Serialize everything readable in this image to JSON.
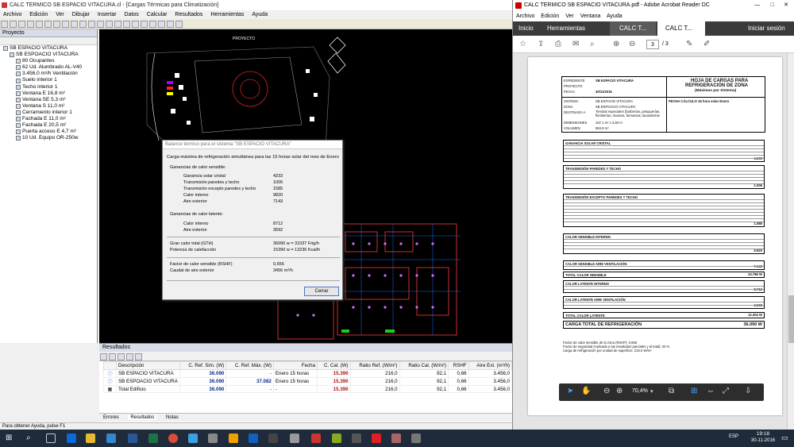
{
  "left_app": {
    "title": "CALC TERMICO SB ESPACIO VITACURA.cl - [Cargas Térmicas para Climatización]",
    "menu": [
      "Archivo",
      "Edición",
      "Ver",
      "Dibujar",
      "Insertar",
      "Datos",
      "Calcular",
      "Resultados",
      "Herramientas",
      "Ayuda"
    ],
    "project_panel_title": "Proyecto",
    "tree": [
      {
        "label": "SB ESPACIO VITACURA",
        "level": 0
      },
      {
        "label": "SB ESPOACIO VITACURA",
        "level": 1
      },
      {
        "label": "80 Ocupantes",
        "level": 2
      },
      {
        "label": "62 Ud. Alumbrado AL-V40",
        "level": 2
      },
      {
        "label": "3.456,0 m³/h Ventilación",
        "level": 2
      },
      {
        "label": "Suelo interior 1",
        "level": 2
      },
      {
        "label": "Techo interior 1",
        "level": 2
      },
      {
        "label": "Ventana E 16,8 m²",
        "level": 2
      },
      {
        "label": "Ventana SE 5,3 m²",
        "level": 2
      },
      {
        "label": "Ventana S 11,0 m²",
        "level": 2
      },
      {
        "label": "Cerramiento interior 1",
        "level": 2
      },
      {
        "label": "Fachada E 11,0 m²",
        "level": 2
      },
      {
        "label": "Fachada E 20,5 m²",
        "level": 2
      },
      {
        "label": "Puerta acceso E 4,7 m²",
        "level": 2
      },
      {
        "label": "10 Ud. Equipo OR-250w",
        "level": 2
      }
    ],
    "cad_label": "PROYECTO",
    "status_bar": "Para obtener Ayuda, pulse F1"
  },
  "dialog": {
    "title": "Balance térmico para el sistema \"SB ESPACIO VITACURA\"",
    "heading": "Carga máxima de refrigeración simultánea para las 15 horas solar del mes de Enero",
    "sensible_title": "Ganancias de calor sensible:",
    "sensible": [
      {
        "label": "Ganancia solar cristal",
        "value": "4233"
      },
      {
        "label": "Transmisión paredes y techo",
        "value": "1006"
      },
      {
        "label": "Transmisión excepto paredes y techo",
        "value": "1585"
      },
      {
        "label": "Calor interno",
        "value": "9820"
      },
      {
        "label": "Aire exterior",
        "value": "7143"
      }
    ],
    "latent_title": "Ganancias de calor latente:",
    "latent": [
      {
        "label": "Calor interno",
        "value": "8712"
      },
      {
        "label": "Aire exterior",
        "value": "3592"
      }
    ],
    "totals": [
      {
        "label": "Gran calor total (GTH)",
        "value": "36090 w = 31037 Frig/h"
      },
      {
        "label": "Potencia de calefacción",
        "value": "15390 w = 13236 Kcal/h"
      }
    ],
    "factors": [
      {
        "label": "Factor de calor sensible (RSHF)",
        "value": "0,656"
      },
      {
        "label": "Caudal de aire exterior",
        "value": "3456 m³/h"
      }
    ],
    "close_button": "Cerrar"
  },
  "results": {
    "panel_title": "Resultados",
    "columns": [
      "Descripción",
      "C. Ref. Sim. (W)",
      "C. Ref. Máx. (W)",
      "Fecha",
      "C. Cal. (W)",
      "Ratio Ref. (W/m²)",
      "Ratio Cal. (W/m²)",
      "RSHF",
      "Aire Ext. (m³/h)"
    ],
    "rows": [
      [
        "SB ESPACIO VITACURA",
        "36.090",
        "-",
        "Enero 15 horas",
        "15.390",
        "216,0",
        "92,1",
        "0,66",
        "3.456,0"
      ],
      [
        "SB ESPOACIO VITACURA",
        "36.090",
        "37.082",
        "Enero 15 horas",
        "15.390",
        "216,0",
        "92,1",
        "0,66",
        "3.456,0"
      ],
      [
        "Total Edificio",
        "36.090",
        "-",
        "-",
        "15.390",
        "216,0",
        "92,1",
        "0,66",
        "3.456,0"
      ]
    ],
    "tabs": [
      "Errores",
      "Resultados",
      "Notas"
    ]
  },
  "pdf": {
    "window_title": "CALC TERMICO SB ESPACIO VITACURA.pdf - Adobe Acrobat Reader DC",
    "menu": [
      "Archivo",
      "Edición",
      "Ver",
      "Ventana",
      "Ayuda"
    ],
    "tabs": [
      "Inicio",
      "Herramientas",
      "CALC T...",
      "CALC T...",
      "Iniciar sesión"
    ],
    "page_current": "3",
    "page_total": "/ 3",
    "zoom": "70,4%",
    "doc": {
      "title1": "HOJA DE CARGAS PARA",
      "title2": "REFRIGERACIÓN DE ZONA",
      "title3": "(Máximas por Sistema)",
      "expediente_label": "EXPEDIENTE",
      "expediente": "SB ESPACIO VITACURA",
      "proyecto_label": "PROYECTO",
      "fecha_label": "FECHA",
      "fecha": "30/11/2016",
      "sistema_label": "SISTEMA",
      "sistema": "SB ESPACIO VITACURA",
      "zona_label": "ZONA",
      "zona": "SB ESPOACIO VITACURA",
      "destinada_label": "DESTINADA A",
      "destinada": "Tiendas especiales (barberías, peluquerías, floristerías, museos, farmacias, lavanderías",
      "dimensiones_label": "DIMENSIONES",
      "dimensiones": "167,1 m² x 3,50 m",
      "volumen_label": "VOLUMEN",
      "volumen": "584,9 m³",
      "fecha_calculo": "FECHA CÁLCULO  15 hora solar Enero",
      "sections": [
        "GANANCIA SOLAR CRISTAL",
        "TRANSMISIÓN PAREDES Y TECHO",
        "TRANSMISIÓN EXCEPTO PAREDES Y TECHO",
        "CALOR SENSIBLE INTERNO",
        "CALOR SENSIBLE AIRE VENTILACIÓN",
        "TOTAL CALOR SENSIBLE",
        "CALOR LATENTE INTERNO",
        "CALOR LATENTE AIRE VENTILACIÓN",
        "TOTAL CALOR LATENTE",
        "CARGA TOTAL DE REFRIGERACIÓN"
      ],
      "section_totals": [
        "4.233",
        "1.006",
        "1.585",
        "9.820",
        "7.143",
        "23.786 W",
        "8.712",
        "3.592",
        "12.304 W",
        "36.090 W"
      ],
      "footnotes": [
        "Factor de calor sensible de la zona (RSHF): 0,656",
        "Factor de seguridad (Aplicado a las resultados parciales y al total): 20 %",
        "Carga de refrigeración por unidad de superficie: 216,0 W/m²"
      ]
    }
  },
  "taskbar": {
    "time": "19:18",
    "date": "30-11-2016",
    "lang": "ESP"
  }
}
